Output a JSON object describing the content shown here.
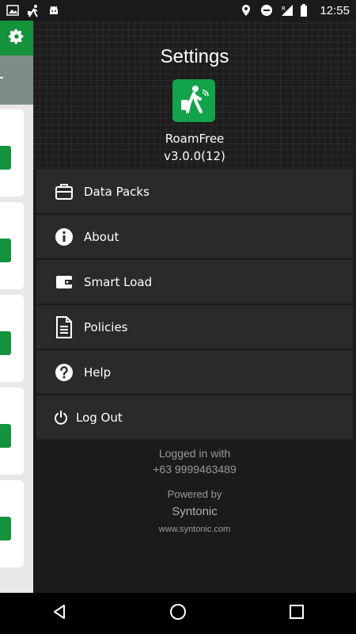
{
  "status_bar": {
    "time": "12:55",
    "left_icons": [
      "image-icon",
      "walker-icon",
      "android-icon"
    ],
    "right_icons": [
      "location-icon",
      "dnd-icon",
      "signal-icon",
      "battery-icon"
    ]
  },
  "drawer": {
    "title": "Settings",
    "app_name": "RoamFree",
    "app_version": "v3.0.0(12)",
    "menu": [
      {
        "label": "Data Packs",
        "icon": "briefcase-icon"
      },
      {
        "label": "About",
        "icon": "info-icon"
      },
      {
        "label": "Smart Load",
        "icon": "wallet-icon"
      },
      {
        "label": "Policies",
        "icon": "document-icon"
      },
      {
        "label": "Help",
        "icon": "help-icon"
      },
      {
        "label": "Log Out",
        "icon": "power-icon"
      }
    ],
    "footer": {
      "logged_in": "Logged in with",
      "phone": "+63 9999463489",
      "powered_by": "Powered by",
      "company": "Syntonic",
      "website": "www.syntonic.com"
    }
  },
  "colors": {
    "accent": "#14923c",
    "drawer_bg": "#1b1b1b",
    "menu_item_bg": "#2a2a2a"
  }
}
